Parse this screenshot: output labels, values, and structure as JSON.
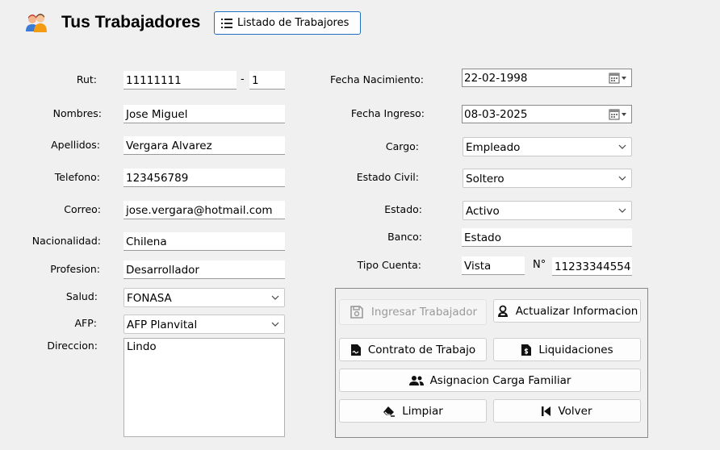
{
  "header": {
    "title": "Tus Trabajadores",
    "list_button_label": "Listado de Trabajores"
  },
  "left_form": {
    "rut_label": "Rut:",
    "rut_value": "11111111",
    "rut_separator": "-",
    "rut_dv": "1",
    "nombres_label": "Nombres:",
    "nombres_value": "Jose Miguel",
    "apellidos_label": "Apellidos:",
    "apellidos_value": "Vergara Alvarez",
    "telefono_label": "Telefono:",
    "telefono_value": "123456789",
    "correo_label": "Correo:",
    "correo_value": "jose.vergara@hotmail.com",
    "nacionalidad_label": "Nacionalidad:",
    "nacionalidad_value": "Chilena",
    "profesion_label": "Profesion:",
    "profesion_value": "Desarrollador",
    "salud_label": "Salud:",
    "salud_value": "FONASA",
    "afp_label": "AFP:",
    "afp_value": "AFP Planvital",
    "direccion_label": "Direccion:",
    "direccion_value": "Lindo"
  },
  "right_form": {
    "fecha_nacimiento_label": "Fecha Nacimiento:",
    "fecha_nacimiento_value": "22-02-1998",
    "fecha_ingreso_label": "Fecha Ingreso:",
    "fecha_ingreso_value": "08-03-2025",
    "cargo_label": "Cargo:",
    "cargo_value": "Empleado",
    "estado_civil_label": "Estado Civil:",
    "estado_civil_value": "Soltero",
    "estado_label": "Estado:",
    "estado_value": "Activo",
    "banco_label": "Banco:",
    "banco_value": "Estado",
    "tipo_cuenta_label": "Tipo Cuenta:",
    "tipo_cuenta_value": "Vista",
    "numero_label": "N°",
    "numero_value": "11233344554"
  },
  "actions": {
    "ingresar": "Ingresar Trabajador",
    "actualizar": "Actualizar Informacion",
    "contrato": "Contrato de Trabajo",
    "liquidaciones": "Liquidaciones",
    "carga_familiar": "Asignacion Carga Familiar",
    "limpiar": "Limpiar",
    "volver": "Volver"
  },
  "colors": {
    "accent_border": "#1f6fc4",
    "background": "#f0f0f0"
  },
  "icons": {
    "title": "workers-icon",
    "list": "list-icon",
    "calendar": "calendar-icon",
    "ingresar": "save-icon",
    "actualizar": "user-update-icon",
    "contrato": "contract-document-icon",
    "liquidaciones": "payslip-document-icon",
    "carga_familiar": "family-group-icon",
    "limpiar": "eraser-icon",
    "volver": "skip-back-icon"
  }
}
